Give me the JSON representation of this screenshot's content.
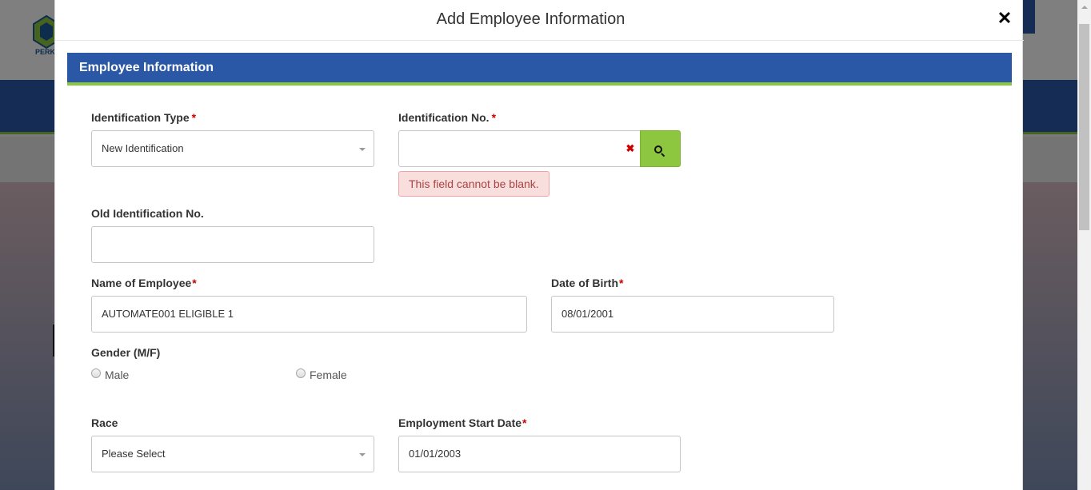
{
  "modal": {
    "title": "Add Employee Information",
    "close_glyph": "✕",
    "section_title": "Employee Information"
  },
  "background": {
    "logo_text": "PERK"
  },
  "form": {
    "identification_type": {
      "label": "Identification Type",
      "required": "*",
      "value": "New Identification"
    },
    "identification_no": {
      "label": "Identification No.",
      "required": "*",
      "value": "",
      "clear_glyph": "✖",
      "error": "This field cannot be blank."
    },
    "old_identification_no": {
      "label": "Old Identification No.",
      "value": ""
    },
    "name_of_employee": {
      "label": "Name of Employee",
      "required": "*",
      "value": "AUTOMATE001 ELIGIBLE 1"
    },
    "date_of_birth": {
      "label": "Date of Birth",
      "required": "*",
      "value": "08/01/2001"
    },
    "gender": {
      "label": "Gender (M/F)",
      "options": [
        "Male",
        "Female"
      ]
    },
    "race": {
      "label": "Race",
      "value": "Please Select"
    },
    "employment_start_date": {
      "label": "Employment Start Date",
      "required": "*",
      "value": "01/01/2003"
    }
  },
  "icons": {
    "close": "close-icon",
    "search": "search-icon",
    "clear": "clear-icon",
    "dropdown": "chevron-down-icon"
  },
  "colors": {
    "section_bar": "#2b58a6",
    "accent_green": "#8dc63f",
    "required": "#cc0000",
    "error_bg": "#f9dede",
    "error_text": "#a94442"
  }
}
